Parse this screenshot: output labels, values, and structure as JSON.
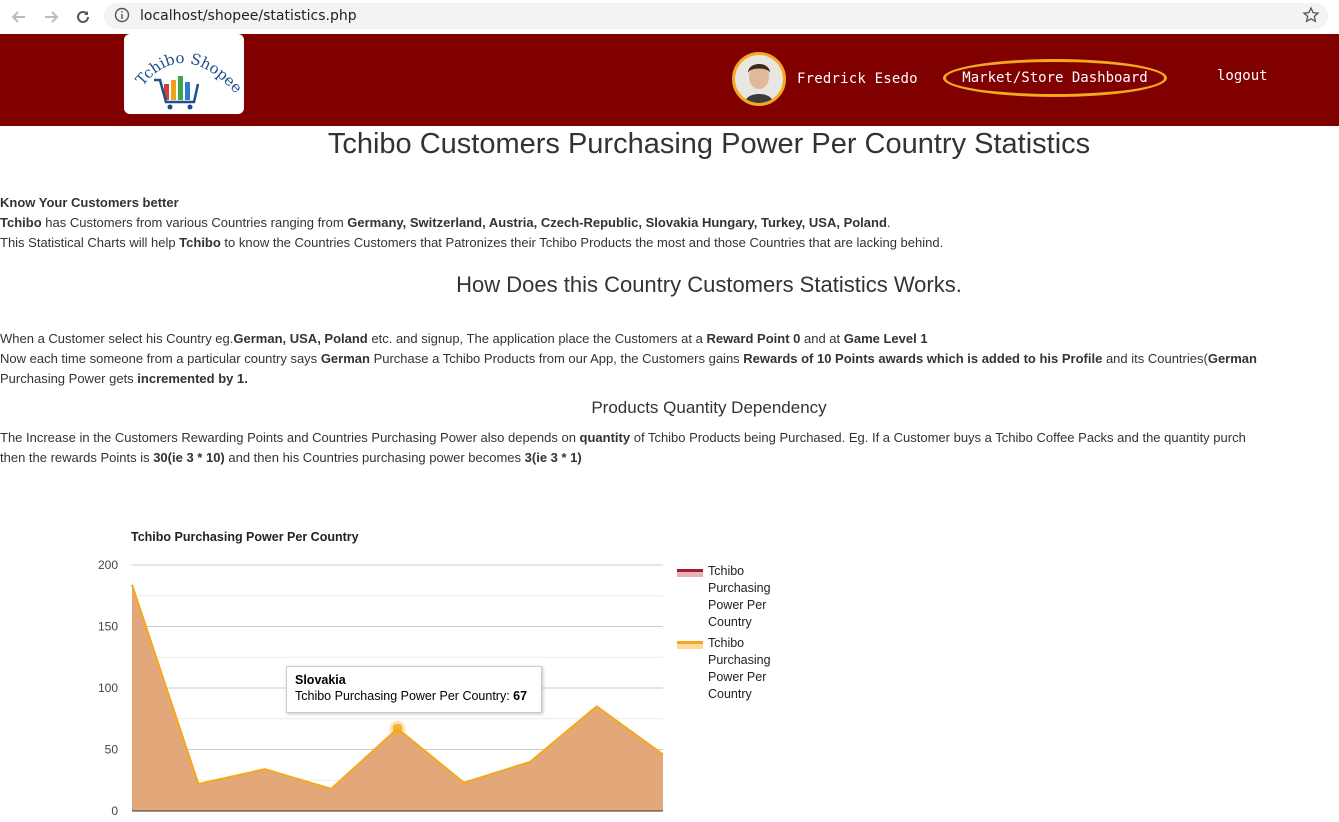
{
  "browser": {
    "url": "localhost/shopee/statistics.php"
  },
  "header": {
    "logo_text": "Tchibo Shopee",
    "user_name": "Fredrick Esedo",
    "dashboard_label": "Market/Store Dashboard",
    "logout_label": "logout",
    "colors": {
      "background": "#800000",
      "accent": "#f4a81d"
    }
  },
  "page": {
    "title": "Tchibo Customers Purchasing Power Per Country Statistics",
    "intro_heading": "Know Your Customers better",
    "intro_line1_brand": "Tchibo",
    "intro_line1_text": " has Customers from various Countries ranging from ",
    "intro_line1_countries": "Germany, Switzerland, Austria, Czech-Republic, Slovakia Hungary, Turkey, USA, Poland",
    "intro_line1_end": ".",
    "intro_line2_a": "This Statistical Charts will help ",
    "intro_line2_brand": "Tchibo",
    "intro_line2_b": " to know the Countries Customers that Patronizes their Tchibo Products the most and those Countries that are lacking behind.",
    "how_heading": "How Does this Country Customers Statistics Works.",
    "how_p1_a": "When a Customer select his Country eg.",
    "how_p1_b": "German, USA, Poland",
    "how_p1_c": " etc. and signup, The application place the Customers at a ",
    "how_p1_d": "Reward Point 0",
    "how_p1_e": " and at ",
    "how_p1_f": "Game Level 1",
    "how_p2_a": "Now each time someone from a particular country says ",
    "how_p2_b": "German",
    "how_p2_c": " Purchase a Tchibo Products from our App, the Customers gains ",
    "how_p2_d": "Rewards of 10 Points awards which is added to his Profile",
    "how_p2_e": " and its Countries(",
    "how_p2_f": "German",
    "how_p3_a": "Purchasing Power gets ",
    "how_p3_b": "incremented by 1.",
    "qty_heading": "Products Quantity Dependency",
    "qty_p1_a": "The Increase in the Customers Rewarding Points and Countries Purchasing Power also depends on ",
    "qty_p1_b": "quantity",
    "qty_p1_c": " of Tchibo Products being Purchased. Eg. If a Customer buys a Tchibo Coffee Packs and the quantity purch",
    "qty_p2_a": "then the rewards Points is ",
    "qty_p2_b": "30(ie 3 * 10)",
    "qty_p2_c": " and then his Countries purchasing power becomes ",
    "qty_p2_d": "3(ie 3 * 1)"
  },
  "tooltip": {
    "title": "Slovakia",
    "label": "Tchibo Purchasing Power Per Country: ",
    "value": "67"
  },
  "chart_data": {
    "type": "area",
    "title": "Tchibo Purchasing Power Per Country",
    "yticks": [
      "200",
      "150",
      "100",
      "50",
      "0"
    ],
    "ylim": [
      0,
      200
    ],
    "x": [
      0,
      1,
      2,
      3,
      4,
      5,
      6,
      7,
      8
    ],
    "series": [
      {
        "name": "Tchibo Purchasing Power Per Country",
        "color": "#f4a81d",
        "fill": "#e3a87a",
        "values": [
          184,
          22,
          34,
          18,
          67,
          23,
          40,
          85,
          46
        ]
      }
    ],
    "legend": [
      {
        "label": "Tchibo Purchasing Power Per Country",
        "color": "#a51c30"
      },
      {
        "label": "Tchibo Purchasing Power Per Country",
        "color": "#f4a81d"
      }
    ],
    "legend_position": "right",
    "grid": true,
    "highlight_index": 4
  }
}
